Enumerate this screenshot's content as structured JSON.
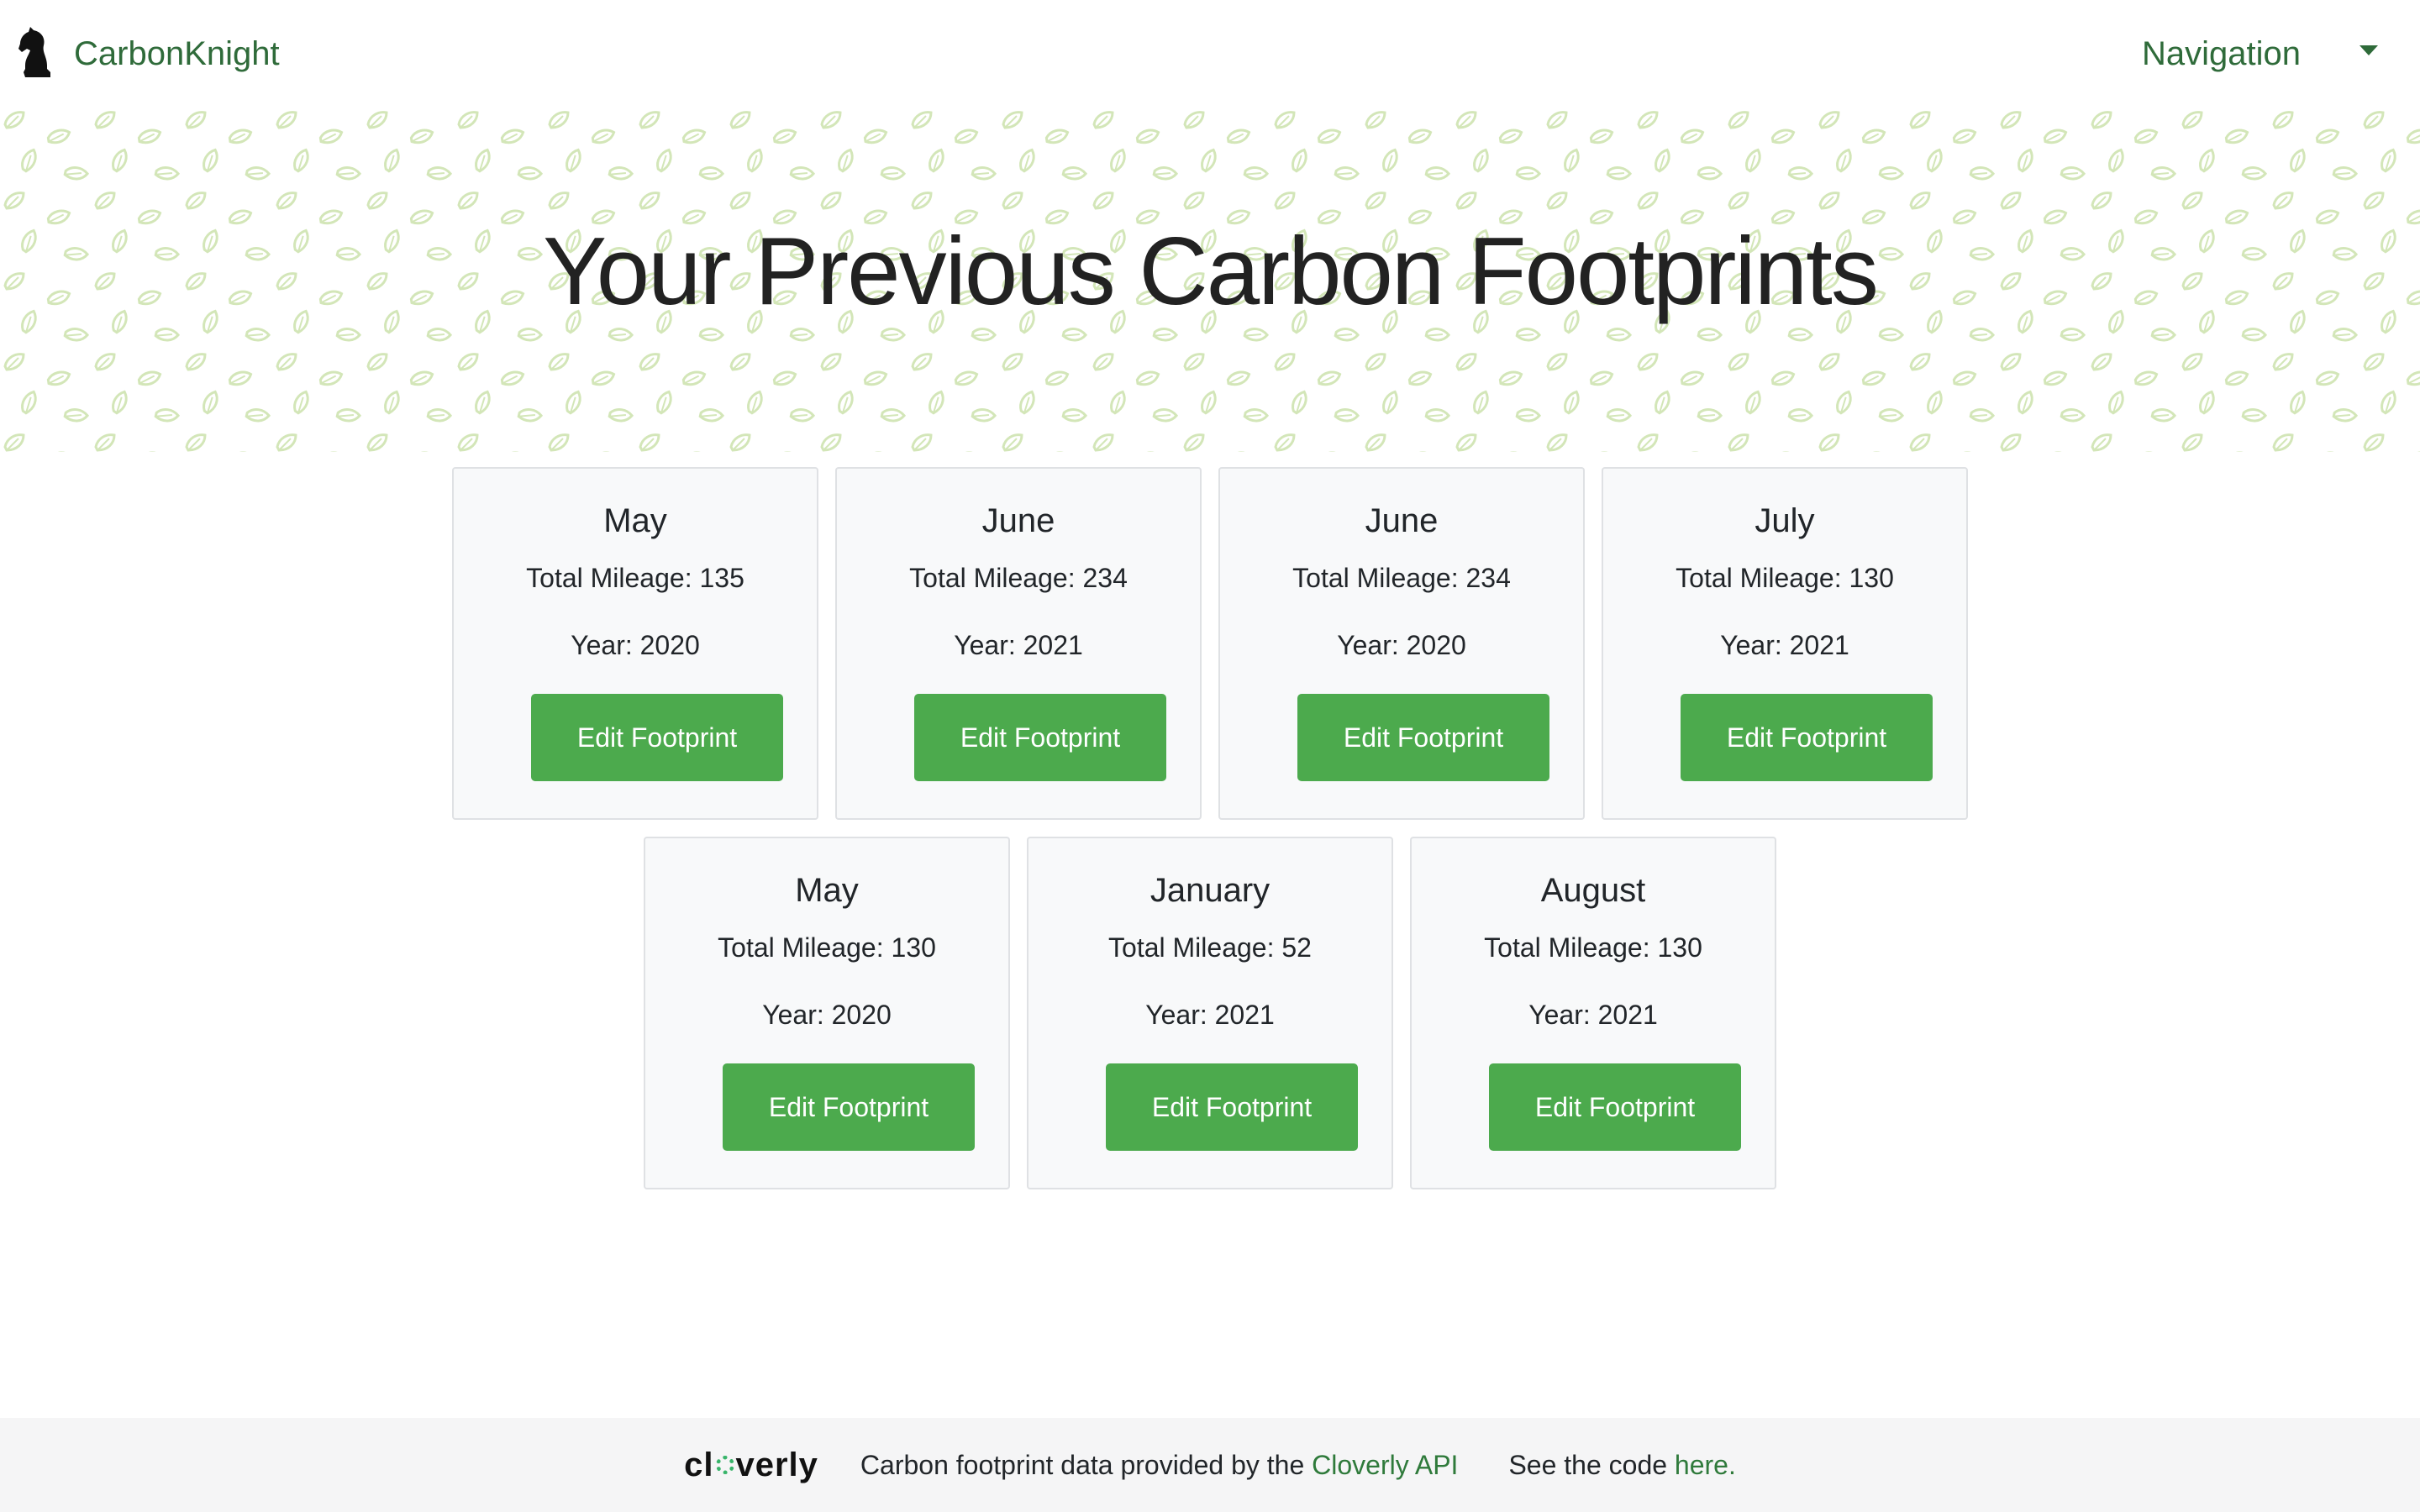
{
  "header": {
    "brand_name": "CarbonKnight",
    "nav_label": "Navigation"
  },
  "hero": {
    "title": "Your Previous Carbon Footprints"
  },
  "cards": [
    {
      "month": "May",
      "mileage": "Total Mileage: 135",
      "year": "Year: 2020",
      "button": "Edit Footprint"
    },
    {
      "month": "June",
      "mileage": "Total Mileage: 234",
      "year": "Year: 2021",
      "button": "Edit Footprint"
    },
    {
      "month": "June",
      "mileage": "Total Mileage: 234",
      "year": "Year: 2020",
      "button": "Edit Footprint"
    },
    {
      "month": "July",
      "mileage": "Total Mileage: 130",
      "year": "Year: 2021",
      "button": "Edit Footprint"
    },
    {
      "month": "May",
      "mileage": "Total Mileage: 130",
      "year": "Year: 2020",
      "button": "Edit Footprint"
    },
    {
      "month": "January",
      "mileage": "Total Mileage: 52",
      "year": "Year: 2021",
      "button": "Edit Footprint"
    },
    {
      "month": "August",
      "mileage": "Total Mileage: 130",
      "year": "Year: 2021",
      "button": "Edit Footprint"
    }
  ],
  "footer": {
    "logo_text_a": "cl",
    "logo_text_b": "verly",
    "data_text": "Carbon footprint data provided by the ",
    "data_link": "Cloverly API",
    "code_text": "See the code ",
    "code_link": "here."
  },
  "colors": {
    "brand": "#2f6b3a",
    "button": "#4caa4d",
    "leaf": "#cfe3b4"
  },
  "icons": {
    "logo": "knight-chess-icon",
    "nav": "caret-down-icon",
    "pattern": "leaf-icon"
  }
}
